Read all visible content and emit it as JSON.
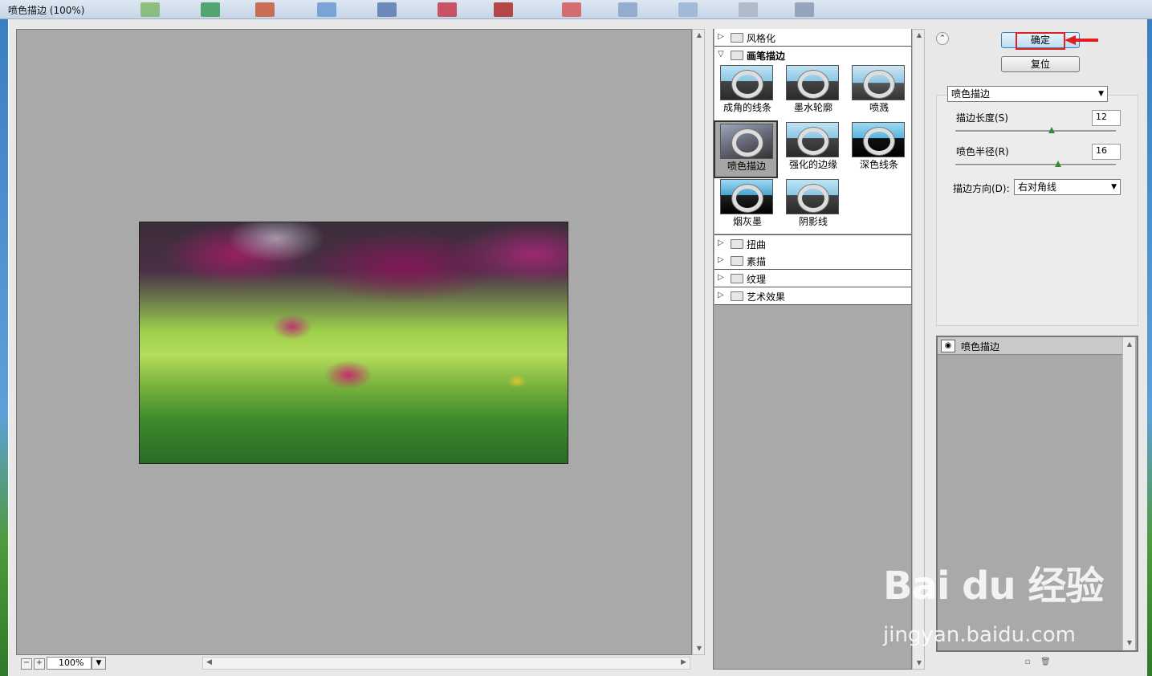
{
  "window": {
    "title": "喷色描边 (100%)"
  },
  "preview": {
    "zoom": "100%",
    "zoom_out": "−",
    "zoom_in": "+"
  },
  "gallery": {
    "categories_top": [
      {
        "label": "风格化",
        "expanded": false
      }
    ],
    "open_category": {
      "label": "画笔描边",
      "expanded": true
    },
    "brush_filters": [
      {
        "label": "成角的线条"
      },
      {
        "label": "墨水轮廓"
      },
      {
        "label": "喷溅"
      },
      {
        "label": "喷色描边",
        "selected": true
      },
      {
        "label": "强化的边缘"
      },
      {
        "label": "深色线条"
      },
      {
        "label": "烟灰墨"
      },
      {
        "label": "阴影线"
      }
    ],
    "categories_bottom": [
      {
        "label": "扭曲"
      },
      {
        "label": "素描"
      },
      {
        "label": "纹理"
      },
      {
        "label": "艺术效果"
      }
    ]
  },
  "buttons": {
    "ok": "确定",
    "reset": "复位"
  },
  "settings": {
    "filter_select": "喷色描边",
    "stroke_length_label": "描边长度(S)",
    "stroke_length_value": "12",
    "stroke_length_fraction": 0.6,
    "spray_radius_label": "喷色半径(R)",
    "spray_radius_value": "16",
    "spray_radius_fraction": 0.64,
    "direction_label": "描边方向(D):",
    "direction_value": "右对角线"
  },
  "layers": {
    "items": [
      {
        "name": "喷色描边",
        "visible": true
      }
    ]
  },
  "watermark": {
    "logo": "Bai du 经验",
    "url": "jingyan.baidu.com"
  },
  "colors": {
    "accent_highlight": "#e02020",
    "ok_button": "#bcdcf2",
    "slider_thumb": "#3a8a3a"
  }
}
